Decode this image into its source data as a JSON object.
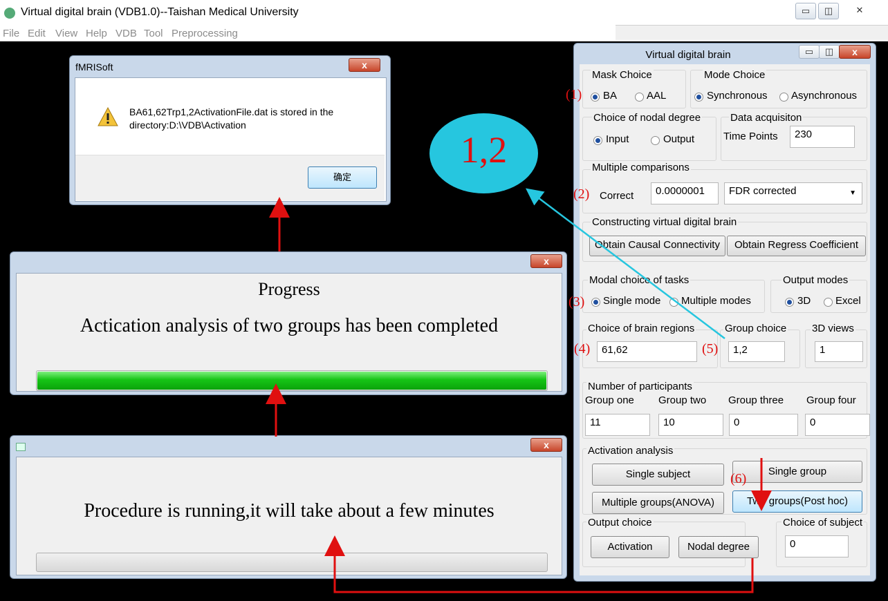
{
  "main_window": {
    "title": "Virtual digital brain (VDB1.0)--Taishan Medical University",
    "minimize": "▭",
    "restore": "◫",
    "close": "✕",
    "menu": [
      "File",
      "Edit",
      "View",
      "Help",
      "VDB",
      "Tool",
      "Preprocessing"
    ]
  },
  "fmri_dialog": {
    "title": "fMRISoft",
    "close": "x",
    "message_line1": "BA61,62Trp1,2ActivationFile.dat is stored in the",
    "message_line2": "directory:D:\\VDB\\Activation",
    "ok_button": "确定"
  },
  "progress_dialog": {
    "close": "x",
    "heading": "Progress",
    "message": "Actication analysis of two groups has been completed",
    "progress_fraction": 1.0
  },
  "running_dialog": {
    "close": "x",
    "message": "Procedure is running,it will take about a few minutes",
    "progress_fraction": 0.0
  },
  "callout": {
    "text": "1,2",
    "color": "#26c6df"
  },
  "vdb_panel": {
    "title": "Virtual   digital   brain",
    "mask_choice": {
      "title": "Mask Choice",
      "options": [
        "BA",
        "AAL"
      ],
      "selected": "BA"
    },
    "mode_choice": {
      "title": "Mode Choice",
      "options": [
        "Synchronous",
        "Asynchronous"
      ],
      "selected": "Synchronous"
    },
    "nodal_degree": {
      "title": "Choice of nodal degree",
      "options": [
        "Input",
        "Output"
      ],
      "selected": "Input"
    },
    "data_acquisition": {
      "title": "Data acquisiton",
      "label": "Time Points",
      "value": "230"
    },
    "multiple_comparisons": {
      "title": "Multiple comparisons",
      "label": "Correct",
      "value": "0.0000001",
      "method": "FDR corrected"
    },
    "constructing": {
      "title": "Constructing virtual digital brain",
      "btn_causal": "Obtain  Causal Connectivity",
      "btn_regress": "Obtain Regress Coefficient"
    },
    "modal_choice": {
      "title": "Modal choice of tasks",
      "options": [
        "Single mode",
        "Multiple modes"
      ],
      "selected": "Single mode"
    },
    "output_modes": {
      "title": "Output modes",
      "options": [
        "3D",
        "Excel"
      ],
      "selected": "3D"
    },
    "brain_regions": {
      "title": "Choice of brain regions",
      "value": "61,62"
    },
    "group_choice": {
      "title": "Group choice",
      "value": "1,2"
    },
    "views_3d": {
      "title": "3D views",
      "value": "1"
    },
    "participants": {
      "title": "Number of participants",
      "labels": [
        "Group one",
        "Group two",
        "Group three",
        "Group four"
      ],
      "values": [
        "11",
        "10",
        "0",
        "0"
      ]
    },
    "activation": {
      "title": "Activation analysis",
      "single_subject": "Single subject",
      "single_group": "Single group",
      "multiple_groups": "Multiple groups(ANOVA)",
      "two_groups": "Two groups(Post hoc)"
    },
    "output_choice": {
      "title": "Output choice",
      "activation": "Activation",
      "nodal_degree": "Nodal degree"
    },
    "choice_of_subject": {
      "title": "Choice of subject",
      "value": "0"
    }
  },
  "annotations": [
    "(1)",
    "(2)",
    "(3)",
    "(4)",
    "(5)",
    "(6)"
  ],
  "arrow_color": "#e01010"
}
